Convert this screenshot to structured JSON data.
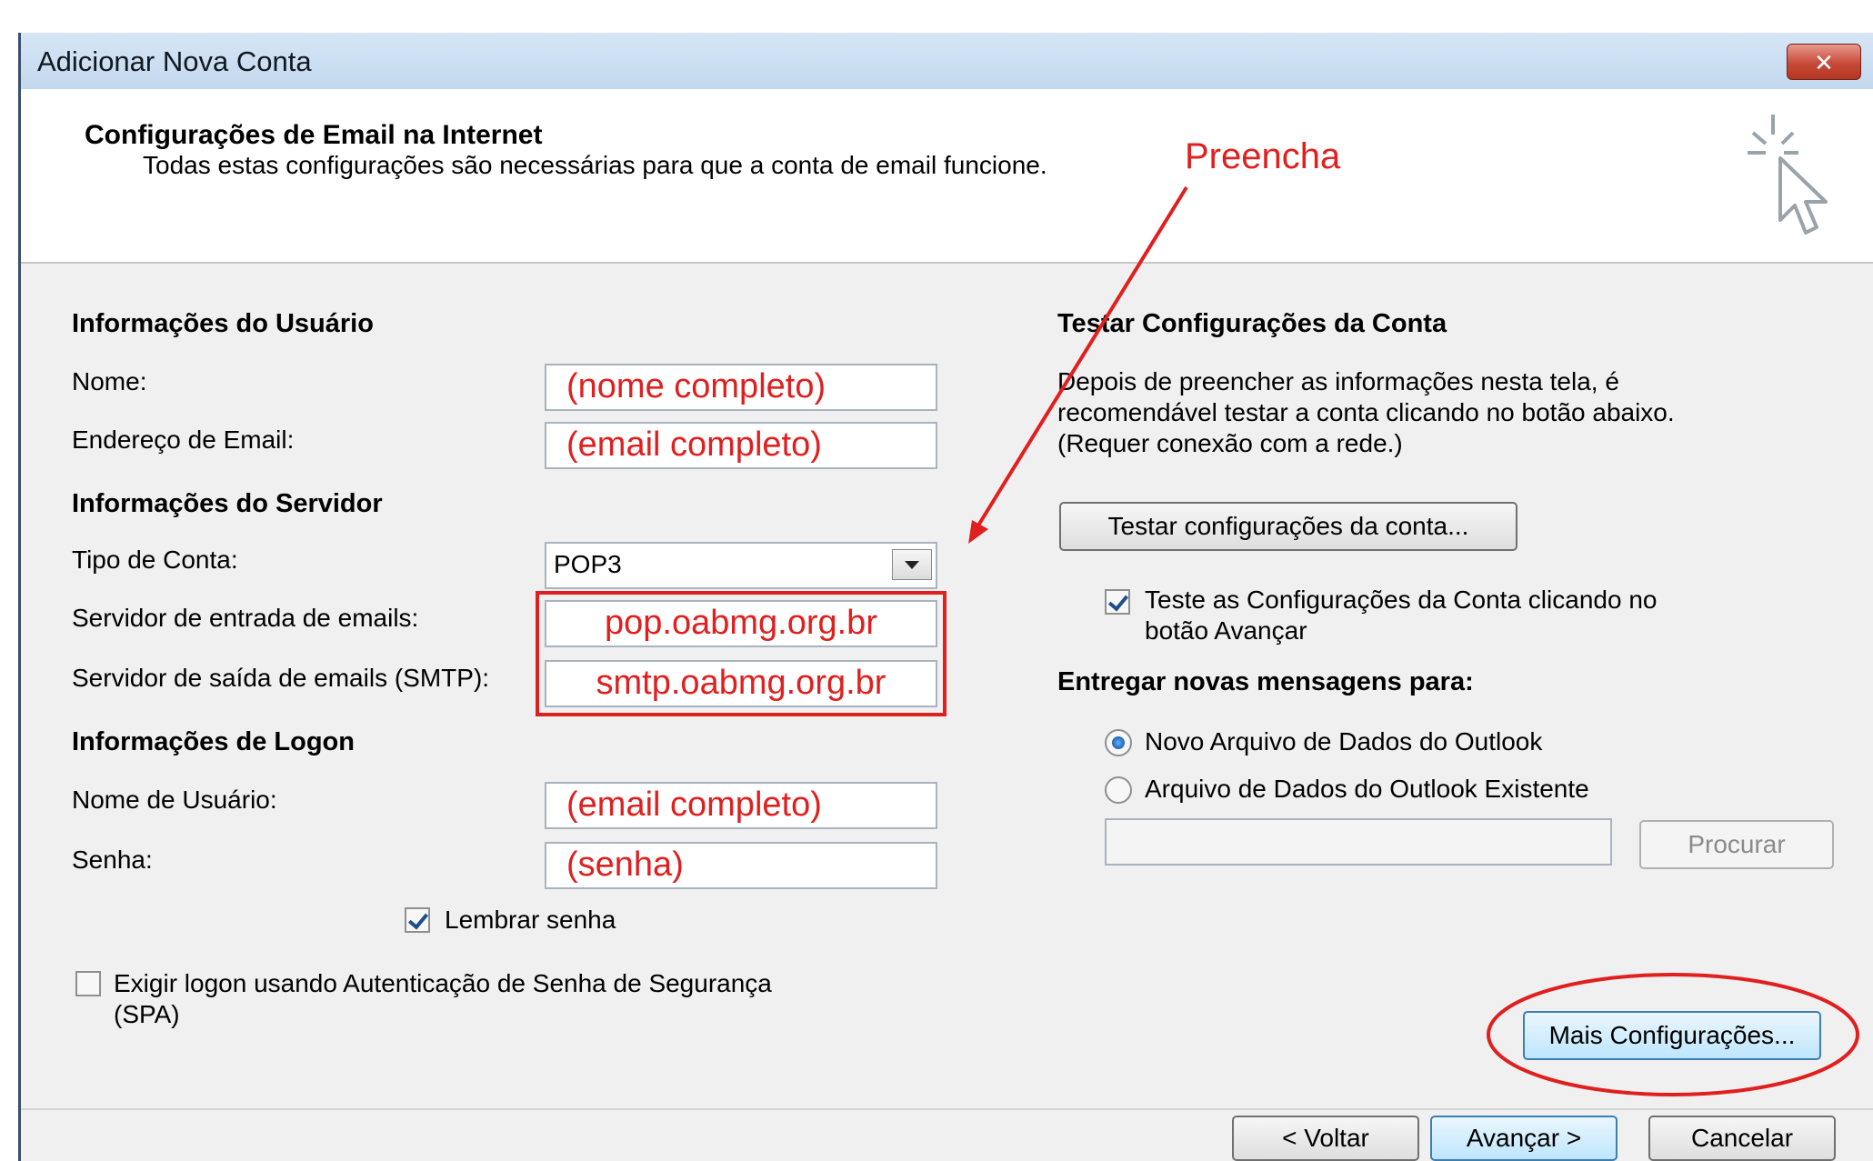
{
  "window": {
    "title": "Adicionar Nova Conta",
    "close_label": "✕"
  },
  "header": {
    "title": "Configurações de Email na Internet",
    "subtitle": "Todas estas configurações são necessárias para que a conta de email funcione."
  },
  "annotation": {
    "text": "Preencha"
  },
  "user_info": {
    "heading": "Informações do Usuário",
    "name_label": "Nome:",
    "name_value": "(nome completo)",
    "email_label": "Endereço de Email:",
    "email_value": "(email completo)"
  },
  "server_info": {
    "heading": "Informações do Servidor",
    "account_type_label": "Tipo de Conta:",
    "account_type_value": "POP3",
    "incoming_label": "Servidor de entrada de emails:",
    "incoming_value": "pop.oabmg.org.br",
    "outgoing_label": "Servidor de saída de emails (SMTP):",
    "outgoing_value": "smtp.oabmg.org.br"
  },
  "logon_info": {
    "heading": "Informações de Logon",
    "username_label": "Nome de Usuário:",
    "username_value": "(email completo)",
    "password_label": "Senha:",
    "password_value": "(senha)",
    "remember_label": "Lembrar senha",
    "spa_label_line1": "Exigir logon usando Autenticação de Senha de Segurança",
    "spa_label_line2": "(SPA)"
  },
  "test_settings": {
    "heading": "Testar Configurações da Conta",
    "desc_line1": "Depois de preencher as informações nesta tela, é",
    "desc_line2": "recomendável testar a conta clicando no botão abaixo.",
    "desc_line3": "(Requer conexão com a rede.)",
    "test_button": "Testar configurações da conta...",
    "auto_test_line1": "Teste as Configurações da Conta clicando no",
    "auto_test_line2": "botão Avançar"
  },
  "deliver": {
    "heading": "Entregar novas mensagens para:",
    "option_new": "Novo Arquivo de Dados do Outlook",
    "option_existing": "Arquivo de Dados do Outlook Existente",
    "browse_button": "Procurar"
  },
  "more_settings_button": "Mais Configurações...",
  "footer": {
    "back_button": "< Voltar",
    "next_button": "Avançar >",
    "cancel_button": "Cancelar"
  },
  "colors": {
    "annotation_red": "#e01f1f",
    "dialog_bg": "#f0f0f0"
  }
}
